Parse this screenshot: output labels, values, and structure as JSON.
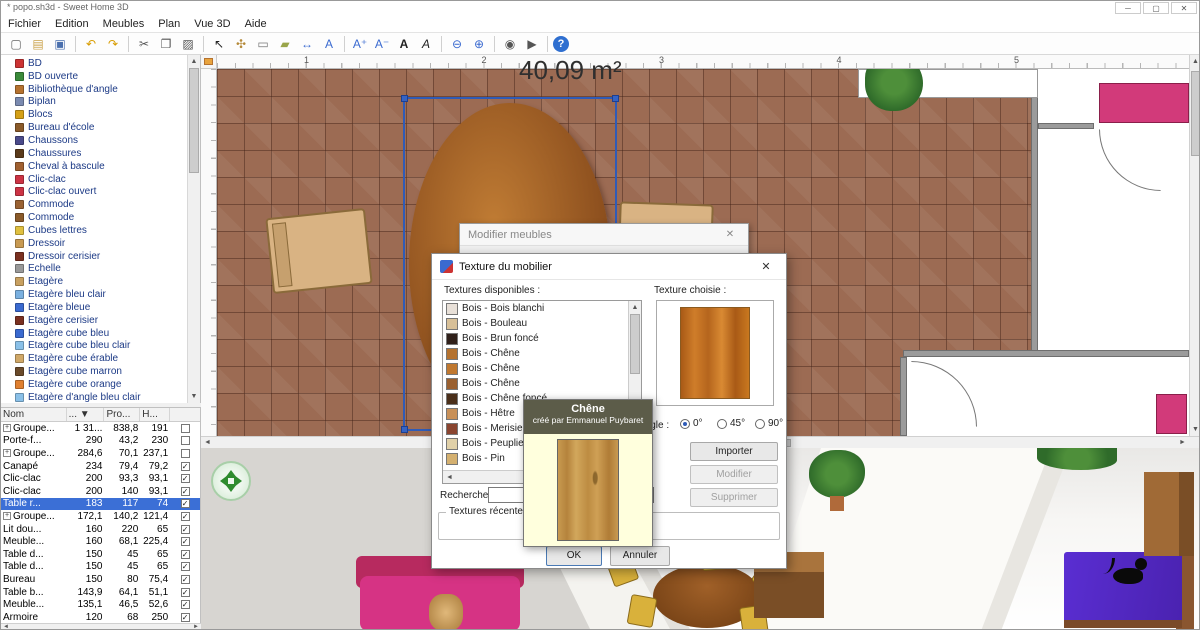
{
  "window": {
    "title": "* popo.sh3d - Sweet Home 3D"
  },
  "icons": {
    "up": "▲",
    "down": "▼",
    "left": "◄",
    "right": "►",
    "close": "✕",
    "minimize": "─",
    "maximize": "▢",
    "check": "✓",
    "plus": "+",
    "sort_desc": "▼"
  },
  "menu": {
    "items": [
      "Fichier",
      "Edition",
      "Meubles",
      "Plan",
      "Vue 3D",
      "Aide"
    ]
  },
  "toolbar": {
    "items": [
      {
        "name": "new",
        "glyph": "▢",
        "color": "#666666"
      },
      {
        "name": "open",
        "glyph": "▤",
        "color": "#caa24a"
      },
      {
        "name": "save",
        "glyph": "▣",
        "color": "#4a6fae"
      },
      {
        "sep": true
      },
      {
        "name": "undo",
        "glyph": "↶",
        "color": "#d89c00"
      },
      {
        "name": "redo",
        "glyph": "↷",
        "color": "#d89c00"
      },
      {
        "sep": true
      },
      {
        "name": "cut",
        "glyph": "✂",
        "color": "#555555"
      },
      {
        "name": "copy",
        "glyph": "❐",
        "color": "#555555"
      },
      {
        "name": "paste",
        "glyph": "▨",
        "color": "#555555"
      },
      {
        "sep": true
      },
      {
        "name": "select",
        "glyph": "↖",
        "color": "#222222"
      },
      {
        "name": "pan",
        "glyph": "✣",
        "color": "#b58a3a"
      },
      {
        "name": "create-walls",
        "glyph": "▭",
        "color": "#777777"
      },
      {
        "name": "create-rooms",
        "glyph": "▰",
        "color": "#9aa54a"
      },
      {
        "name": "create-dimensions",
        "glyph": "↔",
        "color": "#3a6ad0"
      },
      {
        "name": "add-text",
        "glyph": "A",
        "color": "#3a6ad0"
      },
      {
        "sep": true
      },
      {
        "name": "text-larger",
        "glyph": "A⁺",
        "color": "#3a6ad0"
      },
      {
        "name": "text-smaller",
        "glyph": "A⁻",
        "color": "#3a6ad0"
      },
      {
        "name": "bold",
        "glyph": "A",
        "color": "#222222",
        "bold": true
      },
      {
        "name": "italic",
        "glyph": "A",
        "color": "#222222",
        "italic": true
      },
      {
        "sep": true
      },
      {
        "name": "zoom-out",
        "glyph": "⊖",
        "color": "#3a6ad0"
      },
      {
        "name": "zoom-in",
        "glyph": "⊕",
        "color": "#3a6ad0"
      },
      {
        "sep": true
      },
      {
        "name": "photo",
        "glyph": "◉",
        "color": "#555555"
      },
      {
        "name": "video",
        "glyph": "▶",
        "color": "#555555"
      },
      {
        "sep": true
      },
      {
        "name": "help",
        "glyph": "?",
        "round": true
      }
    ]
  },
  "catalog": {
    "items": [
      {
        "label": "BD",
        "color": "#cc3333"
      },
      {
        "label": "BD ouverte",
        "color": "#3a8a3a"
      },
      {
        "label": "Bibliothèque d'angle",
        "color": "#b5722f"
      },
      {
        "label": "Biplan",
        "color": "#7a8ab0"
      },
      {
        "label": "Blocs",
        "color": "#d4a017"
      },
      {
        "label": "Bureau d'école",
        "color": "#8a5a2a"
      },
      {
        "label": "Chaussons",
        "color": "#4a4a8a"
      },
      {
        "label": "Chaussures",
        "color": "#5a3a1a"
      },
      {
        "label": "Cheval à bascule",
        "color": "#a06030"
      },
      {
        "label": "Clic-clac",
        "color": "#cc3344"
      },
      {
        "label": "Clic-clac ouvert",
        "color": "#cc3344"
      },
      {
        "label": "Commode",
        "color": "#9a6233"
      },
      {
        "label": "Commode",
        "color": "#8a5a2a"
      },
      {
        "label": "Cubes lettres",
        "color": "#e0c040"
      },
      {
        "label": "Dressoir",
        "color": "#c89a52"
      },
      {
        "label": "Dressoir cerisier",
        "color": "#7a3020"
      },
      {
        "label": "Echelle",
        "color": "#999999"
      },
      {
        "label": "Etagère",
        "color": "#c8a060"
      },
      {
        "label": "Etagère bleu clair",
        "color": "#7ab0e0"
      },
      {
        "label": "Etagère bleue",
        "color": "#3a6ad0"
      },
      {
        "label": "Etagère cerisier",
        "color": "#7a3020"
      },
      {
        "label": "Etagère cube bleu",
        "color": "#3a6ad0"
      },
      {
        "label": "Etagère cube bleu clair",
        "color": "#8ac0e8"
      },
      {
        "label": "Etagère cube érable",
        "color": "#d0a868"
      },
      {
        "label": "Etagère cube marron",
        "color": "#6a4a2a"
      },
      {
        "label": "Etagère cube orange",
        "color": "#e08030"
      },
      {
        "label": "Etagère d'angle bleu clair",
        "color": "#8ac0e8"
      }
    ]
  },
  "furniture": {
    "columns": [
      {
        "label": "Nom"
      },
      {
        "label": "...",
        "sort": "▼"
      },
      {
        "label": "Pro..."
      },
      {
        "label": "H..."
      },
      {
        "label": ""
      }
    ],
    "rows": [
      {
        "name": "Groupe...",
        "w": "1 31...",
        "d": "838,8",
        "h": "191",
        "group": true,
        "checked": false
      },
      {
        "name": "Porte-f...",
        "w": "290",
        "d": "43,2",
        "h": "230",
        "checked": false
      },
      {
        "name": "Groupe...",
        "w": "284,6",
        "d": "70,1",
        "h": "237,1",
        "group": true,
        "checked": false
      },
      {
        "name": "Canapé",
        "w": "234",
        "d": "79,4",
        "h": "79,2",
        "checked": true
      },
      {
        "name": "Clic-clac",
        "w": "200",
        "d": "93,3",
        "h": "93,1",
        "checked": true
      },
      {
        "name": "Clic-clac",
        "w": "200",
        "d": "140",
        "h": "93,1",
        "checked": true
      },
      {
        "name": "Table r...",
        "w": "183",
        "d": "117",
        "h": "74",
        "checked": true,
        "selected": true
      },
      {
        "name": "Groupe...",
        "w": "172,1",
        "d": "140,2",
        "h": "121,4",
        "group": true,
        "checked": true
      },
      {
        "name": "Lit dou...",
        "w": "160",
        "d": "220",
        "h": "65",
        "checked": true
      },
      {
        "name": "Meuble...",
        "w": "160",
        "d": "68,1",
        "h": "225,4",
        "checked": true
      },
      {
        "name": "Table d...",
        "w": "150",
        "d": "45",
        "h": "65",
        "checked": true
      },
      {
        "name": "Table d...",
        "w": "150",
        "d": "45",
        "h": "65",
        "checked": true
      },
      {
        "name": "Bureau",
        "w": "150",
        "d": "80",
        "h": "75,4",
        "checked": true
      },
      {
        "name": "Table b...",
        "w": "143,9",
        "d": "64,1",
        "h": "51,1",
        "checked": true
      },
      {
        "name": "Meuble...",
        "w": "135,1",
        "d": "46,5",
        "h": "52,6",
        "checked": true
      },
      {
        "name": "Armoire",
        "w": "120",
        "d": "68",
        "h": "250",
        "checked": true
      }
    ]
  },
  "plan": {
    "area_label": "40,09 m²",
    "ruler_numbers": [
      "1",
      "2",
      "3",
      "4",
      "5"
    ]
  },
  "dialogs": {
    "modify_furniture": {
      "title": "Modifier meubles"
    },
    "texture": {
      "title": "Texture du mobilier",
      "available_label": "Textures disponibles :",
      "chosen_label": "Texture choisie :",
      "textures": [
        {
          "label": "Bois - Bois blanchi",
          "color": "#e8e0d8"
        },
        {
          "label": "Bois - Bouleau",
          "color": "#d8c098"
        },
        {
          "label": "Bois - Brun foncé",
          "color": "#30201a"
        },
        {
          "label": "Bois - Chêne",
          "color": "#b5722f"
        },
        {
          "label": "Bois - Chêne",
          "color": "#c07830"
        },
        {
          "label": "Bois - Chêne",
          "color": "#9a6030"
        },
        {
          "label": "Bois - Chêne foncé",
          "color": "#4a2f1a"
        },
        {
          "label": "Bois - Hêtre",
          "color": "#c89058"
        },
        {
          "label": "Bois - Merisier",
          "color": "#8a4530"
        },
        {
          "label": "Bois - Peuplier",
          "color": "#e0d0a8"
        },
        {
          "label": "Bois - Pin",
          "color": "#d4b070"
        }
      ],
      "angle_label": "Angle :",
      "angles": [
        {
          "label": "0°",
          "selected": true
        },
        {
          "label": "45°",
          "selected": false
        },
        {
          "label": "90°",
          "selected": false
        }
      ],
      "buttons": {
        "import": "Importer",
        "modify": "Modifier",
        "delete": "Supprimer",
        "ok": "OK",
        "cancel": "Annuler"
      },
      "search_label": "Recherche:",
      "search_value": "",
      "recent_label": "Textures récentes"
    },
    "tooltip": {
      "name": "Chêne",
      "author": "créé par Emmanuel Puybaret"
    }
  }
}
